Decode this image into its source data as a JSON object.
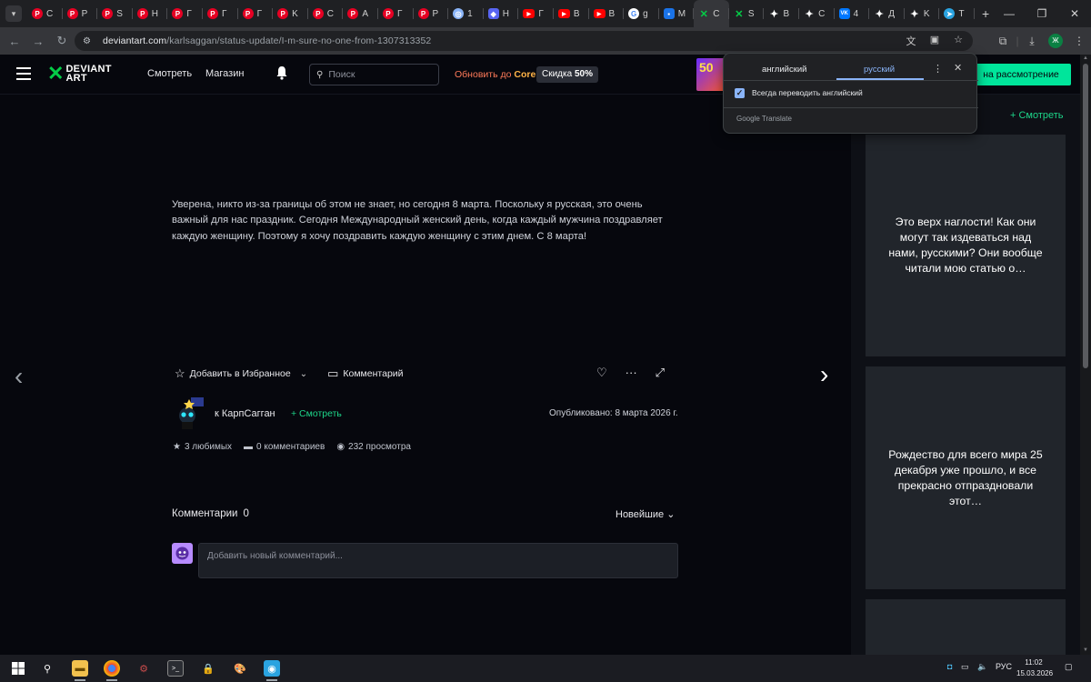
{
  "browser": {
    "tabs": [
      {
        "icon": "pinterest-icon",
        "label": "C",
        "kind": "pin"
      },
      {
        "icon": "pinterest-icon",
        "label": "P",
        "kind": "pin"
      },
      {
        "icon": "pinterest-icon",
        "label": "S",
        "kind": "pin"
      },
      {
        "icon": "pinterest-icon",
        "label": "H",
        "kind": "pin"
      },
      {
        "icon": "pinterest-icon",
        "label": "Г",
        "kind": "pin"
      },
      {
        "icon": "pinterest-icon",
        "label": "Г",
        "kind": "pin"
      },
      {
        "icon": "pinterest-icon",
        "label": "Г",
        "kind": "pin"
      },
      {
        "icon": "pinterest-icon",
        "label": "K",
        "kind": "pin"
      },
      {
        "icon": "pinterest-icon",
        "label": "C",
        "kind": "pin"
      },
      {
        "icon": "pinterest-icon",
        "label": "A",
        "kind": "pin"
      },
      {
        "icon": "pinterest-icon",
        "label": "Г",
        "kind": "pin"
      },
      {
        "icon": "pinterest-icon",
        "label": "P",
        "kind": "pin"
      },
      {
        "icon": "globe-icon",
        "label": "1",
        "kind": "globe"
      },
      {
        "icon": "discord-icon",
        "label": "H",
        "kind": "blue"
      },
      {
        "icon": "youtube-icon",
        "label": "Г",
        "kind": "yt"
      },
      {
        "icon": "youtube-icon",
        "label": "B",
        "kind": "yt"
      },
      {
        "icon": "youtube-icon",
        "label": "B",
        "kind": "yt"
      },
      {
        "icon": "google-icon",
        "label": "g",
        "kind": "g"
      },
      {
        "icon": "messages-icon",
        "label": "M",
        "kind": "msg"
      },
      {
        "icon": "deviantart-icon",
        "label": "C",
        "kind": "da",
        "active": true
      },
      {
        "icon": "deviantart-icon",
        "label": "S",
        "kind": "da"
      },
      {
        "icon": "sparkle-icon",
        "label": "B",
        "kind": "spark"
      },
      {
        "icon": "sparkle-icon",
        "label": "C",
        "kind": "spark"
      },
      {
        "icon": "vk-icon",
        "label": "4",
        "kind": "vk"
      },
      {
        "icon": "sparkle-icon",
        "label": "Д",
        "kind": "spark"
      },
      {
        "icon": "sparkle-icon",
        "label": "K",
        "kind": "spark"
      },
      {
        "icon": "telegram-icon",
        "label": "T",
        "kind": "tg"
      }
    ],
    "url_host": "deviantart.com",
    "url_path": "/karlsaggan/status-update/I-m-sure-no-one-from-1307313352",
    "profile_initial": "Ж"
  },
  "header": {
    "nav_watch": "Смотреть",
    "nav_shop": "Магазин",
    "search_placeholder": "Поиск",
    "upgrade_prefix": "Обновить до",
    "upgrade_core": "Core",
    "discount_prefix": "Скидка",
    "discount_value": "50%",
    "promo_text": "50",
    "submit_label": "на рассмотрение",
    "accent_color": "#00e59b"
  },
  "post": {
    "text": "Уверена, никто из-за границы об этом не знает, но сегодня 8 марта. Поскольку я русская, это очень важный для нас праздник. Сегодня Международный женский день, когда каждый мужчина поздравляет каждую женщину. Поэтому я хочу поздравить каждую женщину с этим днем. С 8 марта!",
    "add_favorite": "Добавить в Избранное",
    "comment_action": "Комментарий",
    "author_prefix": "к",
    "author_name": "КарпСагган",
    "watch_author": "+ Смотреть",
    "published": "Опубликовано: 8 марта 2026 г.",
    "favorites": "3 любимых",
    "comments_count_text": "0 комментариев",
    "views": "232 просмотра"
  },
  "comments": {
    "title": "Комментарии",
    "count": "0",
    "sort": "Новейшие",
    "placeholder": "Добавить новый комментарий..."
  },
  "sidebar": {
    "watch_more": "+ Смотреть",
    "cards": [
      "Это верх наглости! Как они могут так издеваться над нами, русскими? Они вообще читали мою статью о…",
      "Рождество для всего мира 25 декабря уже прошло, и все прекрасно отпраздновали этот…",
      ""
    ]
  },
  "translate_popup": {
    "source_lang": "английский",
    "target_lang": "русский",
    "always_translate": "Всегда переводить английский",
    "brand": "Google Translate"
  },
  "taskbar": {
    "language": "РУС",
    "time": "11:02",
    "date": "15.03.2026"
  }
}
